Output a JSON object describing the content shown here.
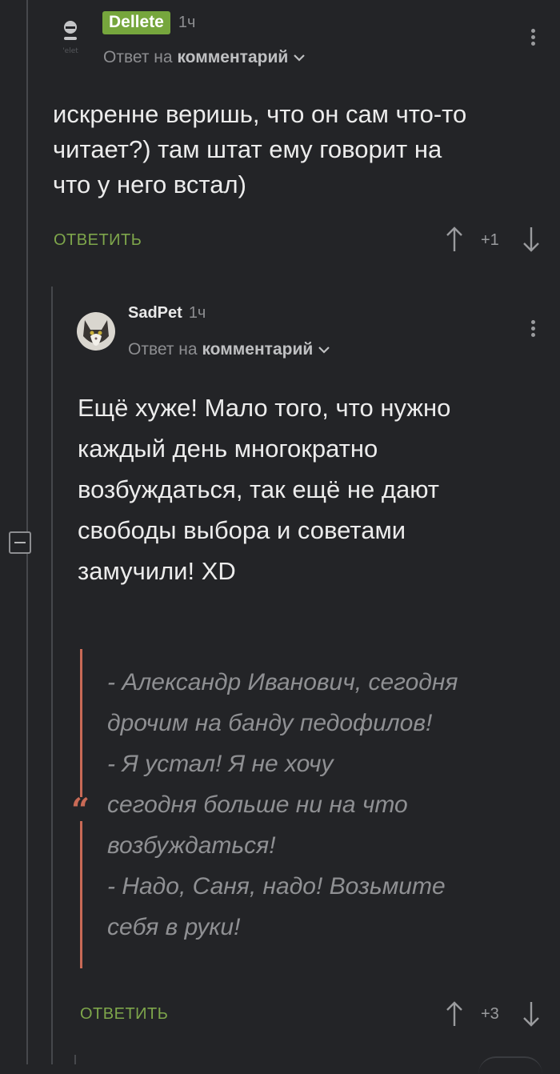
{
  "comment1": {
    "username": "Dellete",
    "time": "1ч",
    "reply_prefix": "Ответ на",
    "reply_target": "комментарий",
    "text_lines": [
      "искренне веришь, что он сам что-то",
      "читает?) там штат ему говорит на",
      "что у него встал)"
    ],
    "reply_label": "ОТВЕТИТЬ",
    "score": "+1"
  },
  "comment2": {
    "username": "SadPet",
    "time": "1ч",
    "reply_prefix": "Ответ на",
    "reply_target": "комментарий",
    "text_lines": [
      "Ещё хуже! Мало того, что нужно",
      "каждый день многократно",
      "возбуждаться, так ещё не дают",
      "свободы выбора и советами",
      "замучили! XD"
    ],
    "quote_lines": [
      "- Александр Иванович, сегодня",
      "дрочим на банду педофилов!",
      "- Я устал! Я не хочу",
      "сегодня больше ни на что",
      "возбуждаться!",
      "- Надо, Саня, надо! Возьмите",
      "себя в руки!"
    ],
    "quote_mark": "“",
    "reply_label": "ОТВЕТИТЬ",
    "score": "+3"
  },
  "colors": {
    "background": "#232427",
    "accent_green": "#7ea64b",
    "badge_green": "#76a63d",
    "quote_bar": "#c96a56"
  },
  "icons": [
    "deleted-avatar-icon",
    "cat-avatar-icon",
    "more-dots-icon",
    "chevron-down-icon",
    "arrow-up-icon",
    "arrow-down-icon",
    "collapse-icon",
    "quote-icon"
  ]
}
